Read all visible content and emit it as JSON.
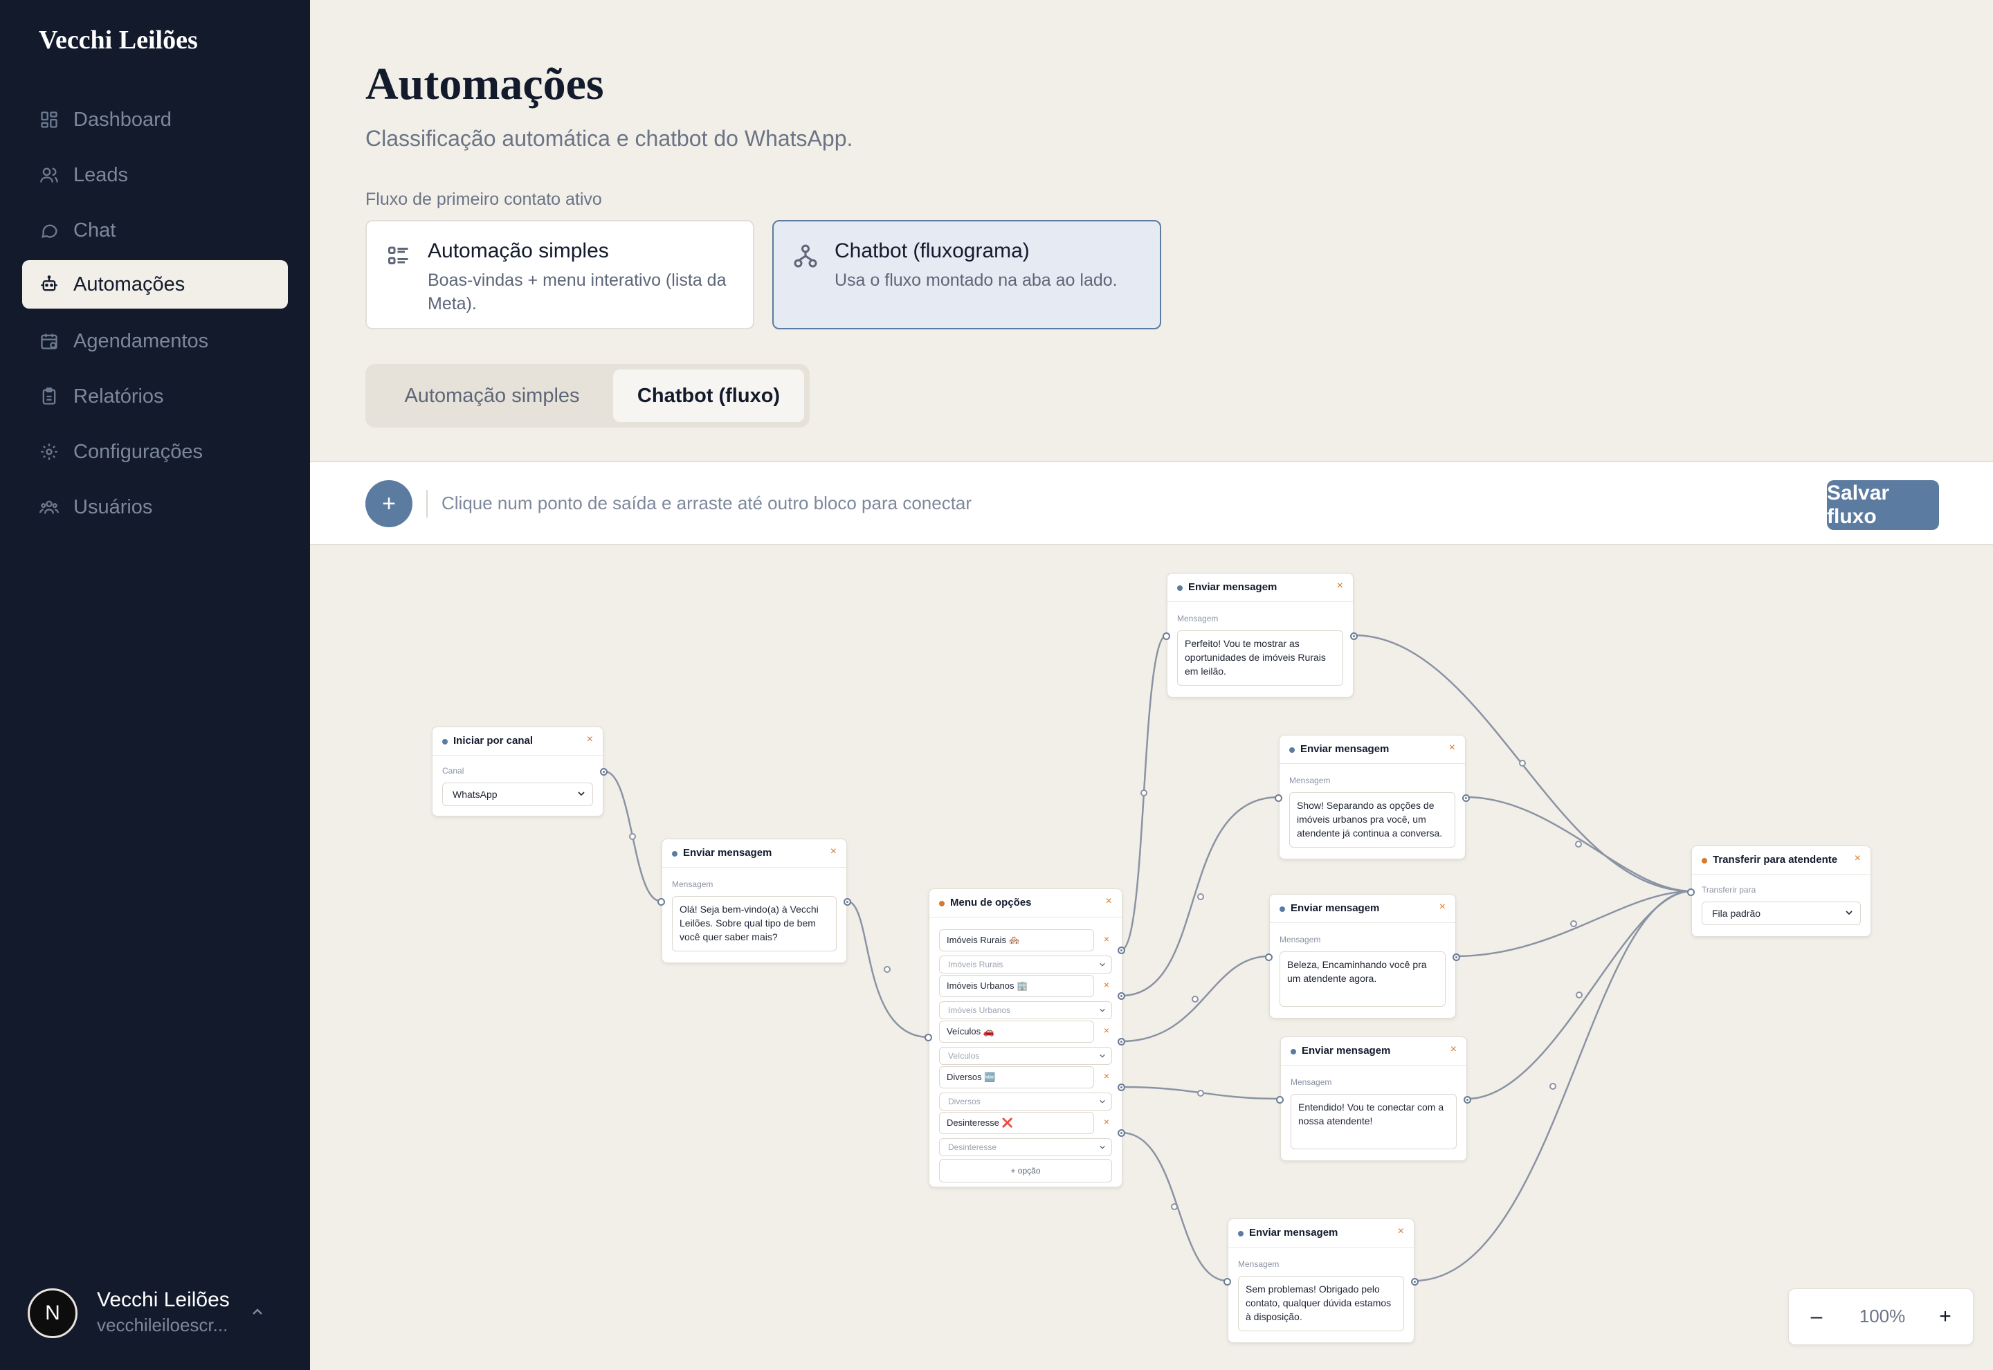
{
  "sidebar": {
    "brand": "Vecchi Leilões",
    "items": [
      {
        "label": "Dashboard",
        "icon": "dashboard-icon"
      },
      {
        "label": "Leads",
        "icon": "users-icon"
      },
      {
        "label": "Chat",
        "icon": "chat-icon"
      },
      {
        "label": "Automações",
        "icon": "bot-icon",
        "active": true
      },
      {
        "label": "Agendamentos",
        "icon": "calendar-icon"
      },
      {
        "label": "Relatórios",
        "icon": "clipboard-icon"
      },
      {
        "label": "Configurações",
        "icon": "gear-icon"
      },
      {
        "label": "Usuários",
        "icon": "team-icon"
      }
    ],
    "user": {
      "initial": "N",
      "name": "Vecchi Leilões",
      "email": "vecchileiloescr..."
    }
  },
  "header": {
    "title": "Automações",
    "subtitle": "Classificação automática e chatbot do WhatsApp.",
    "active_flow_label": "Fluxo de primeiro contato ativo"
  },
  "mode_cards": [
    {
      "title": "Automação simples",
      "description": "Boas-vindas + menu interativo (lista da Meta).",
      "icon": "list-icon",
      "selected": false
    },
    {
      "title": "Chatbot (fluxograma)",
      "description": "Usa o fluxo montado na aba ao lado.",
      "icon": "flowchart-icon",
      "selected": true
    }
  ],
  "tabs": [
    {
      "label": "Automação simples",
      "active": false
    },
    {
      "label": "Chatbot (fluxo)",
      "active": true
    }
  ],
  "toolbar": {
    "add_label": "+",
    "hint": "Clique num ponto de saída e arraste até outro bloco para conectar",
    "save_label": "Salvar fluxo"
  },
  "flow": {
    "start": {
      "title": "Iniciar por canal",
      "close": "×",
      "field_label": "Canal",
      "value": "WhatsApp"
    },
    "welcome": {
      "title": "Enviar mensagem",
      "close": "×",
      "field_label": "Mensagem",
      "text": "Olá! Seja bem-vindo(a) à Vecchi Leilões. Sobre qual tipo de bem você quer saber mais?"
    },
    "menu": {
      "title": "Menu de opções",
      "close": "×",
      "options": [
        {
          "label": "Imóveis Rurais 🏘️",
          "placeholder": "Imóveis Rurais",
          "remove": "×"
        },
        {
          "label": "Imóveis Urbanos 🏢",
          "placeholder": "Imóveis Urbanos",
          "remove": "×"
        },
        {
          "label": "Veículos 🚗",
          "placeholder": "Veículos",
          "remove": "×"
        },
        {
          "label": "Diversos 🆕",
          "placeholder": "Diversos",
          "remove": "×"
        },
        {
          "label": "Desinteresse ❌",
          "placeholder": "Desinteresse",
          "remove": "×"
        }
      ],
      "add_option": "+ opção"
    },
    "messages": [
      {
        "title": "Enviar mensagem",
        "close": "×",
        "field_label": "Mensagem",
        "text": "Perfeito! Vou te mostrar as oportunidades de imóveis Rurais em leilão."
      },
      {
        "title": "Enviar mensagem",
        "close": "×",
        "field_label": "Mensagem",
        "text": "Show! Separando as opções de imóveis urbanos pra você, um atendente já continua a conversa."
      },
      {
        "title": "Enviar mensagem",
        "close": "×",
        "field_label": "Mensagem",
        "text": "Beleza, Encaminhando você pra um atendente agora."
      },
      {
        "title": "Enviar mensagem",
        "close": "×",
        "field_label": "Mensagem",
        "text": "Entendido! Vou te conectar com a nossa atendente!"
      },
      {
        "title": "Enviar mensagem",
        "close": "×",
        "field_label": "Mensagem",
        "text": "Sem problemas! Obrigado pelo contato, qualquer dúvida estamos à disposição."
      }
    ],
    "transfer": {
      "title": "Transferir para atendente",
      "close": "×",
      "field_label": "Transferir para",
      "value": "Fila padrão"
    }
  },
  "zoom": {
    "minus": "–",
    "value": "100%",
    "plus": "+"
  },
  "colors": {
    "sidebar_bg": "#121a2c",
    "page_bg": "#f2efe9",
    "accent": "#5b7ba0",
    "close_accent": "#d9792b"
  }
}
